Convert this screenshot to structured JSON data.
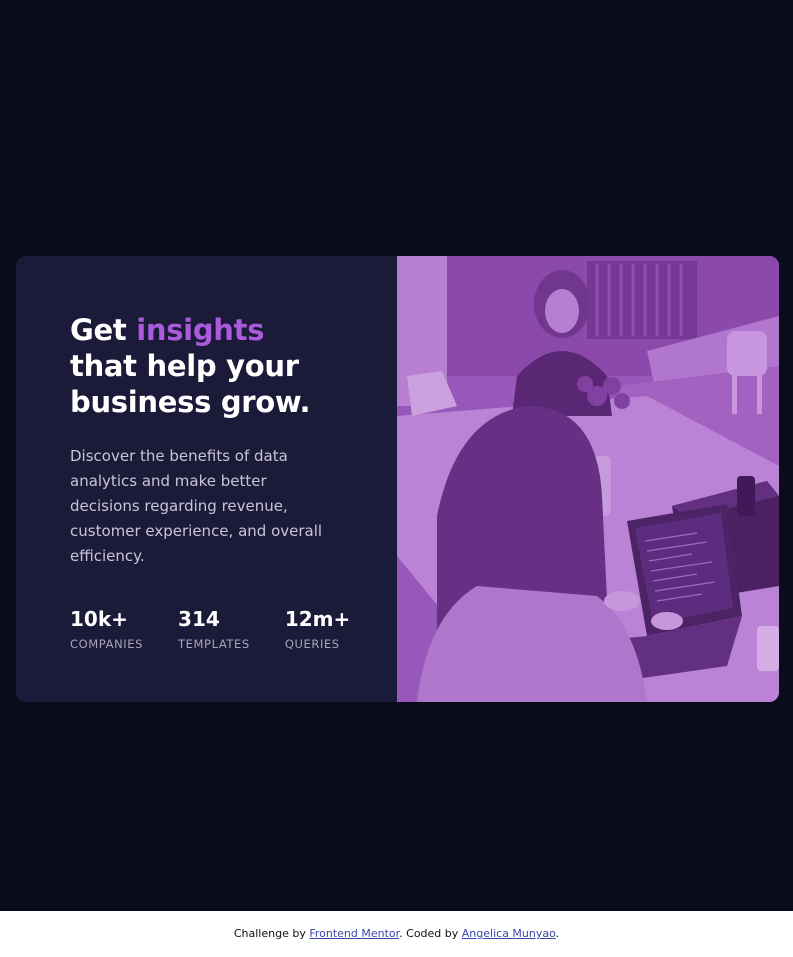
{
  "card": {
    "heading": {
      "before": "Get ",
      "accent": "insights",
      "after": " that help your business grow."
    },
    "description": "Discover the benefits of data analytics and make better decisions regarding revenue, customer experience, and overall efficiency.",
    "stats": [
      {
        "value": "10k+",
        "label": "COMPANIES"
      },
      {
        "value": "314",
        "label": "TEMPLATES"
      },
      {
        "value": "12m+",
        "label": "QUERIES"
      }
    ],
    "image": {
      "icon": "team-working-photo"
    }
  },
  "attribution": {
    "challenge_prefix": "Challenge by ",
    "challenge_link": "Frontend Mentor",
    "coded_prefix": ". Coded by ",
    "author_link": "Angelica Munyao",
    "suffix": "."
  },
  "colors": {
    "page_bg": "#0a0c1b",
    "card_bg": "#1c1a39",
    "accent": "#a95bdb",
    "image_tint": "#8e4cae",
    "link": "#3a46a8"
  }
}
